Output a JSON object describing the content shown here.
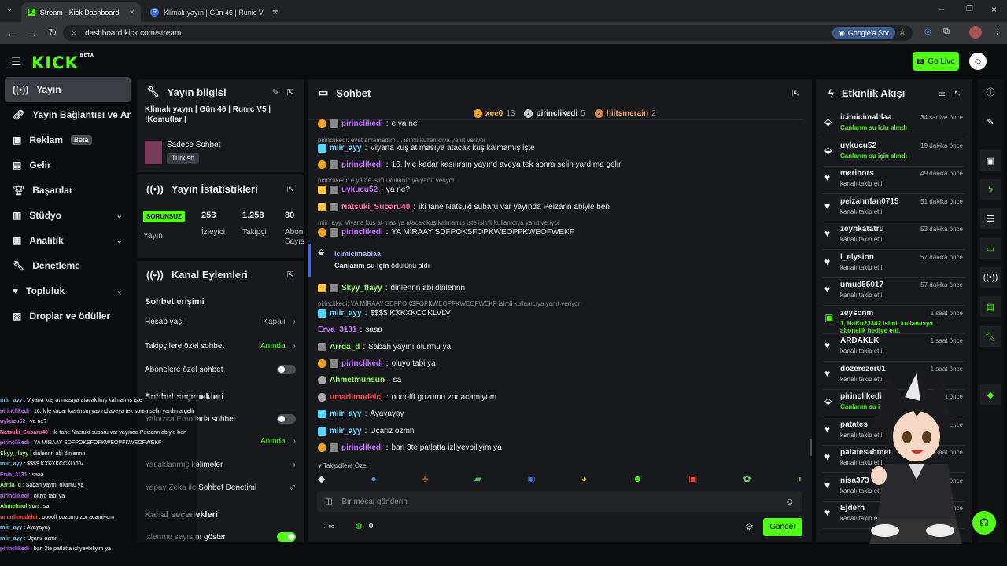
{
  "browser": {
    "tabs": [
      {
        "title": "Stream - Kick Dashboard"
      },
      {
        "title": "Klimalı yayın | Gün 46 | Runic V"
      }
    ],
    "url": "dashboard.kick.com/stream",
    "google_sor": "Google'a Sor"
  },
  "header": {
    "logo": "KICK",
    "logo_tag": "BETA",
    "go_live": "Go Live"
  },
  "sidebar": {
    "items": [
      {
        "label": "Yayın",
        "icon": "broadcast-icon"
      },
      {
        "label": "Yayın Bağlantısı ve Anahtar",
        "icon": "link-icon"
      },
      {
        "label": "Reklam",
        "icon": "ad-icon",
        "badge": "Beta"
      },
      {
        "label": "Gelir",
        "icon": "chart-icon"
      },
      {
        "label": "Başarılar",
        "icon": "trophy-icon"
      },
      {
        "label": "Stüdyo",
        "icon": "studio-icon"
      },
      {
        "label": "Analitik",
        "icon": "analytics-icon"
      },
      {
        "label": "Denetleme",
        "icon": "wrench-icon"
      },
      {
        "label": "Topluluk",
        "icon": "community-icon"
      },
      {
        "label": "Droplar ve ödüller",
        "icon": "gift-icon"
      }
    ]
  },
  "stream_info": {
    "title": "Yayın bilgisi",
    "stream_title": "Klimalı yayın | Gün 46 | Runic V5 | !Komutlar |",
    "category": "Sadece Sohbet",
    "language": "Turkish"
  },
  "stats": {
    "title": "Yayın İstatistikleri",
    "status": "SORUNSUZ",
    "status_label": "Yayın",
    "viewers": "253",
    "viewers_label": "İzleyici",
    "followers": "1.258",
    "followers_label": "Takipçi",
    "subs": "80",
    "subs_label": "Abon Sayısı"
  },
  "channel_actions": {
    "title": "Kanal Eylemleri",
    "chat_access": "Sohbet erişimi",
    "account_age": "Hesap yaşı",
    "account_age_value": "Kapalı",
    "followers_only": "Takipçilere özel sohbet",
    "followers_only_value": "Anında",
    "subs_only": "Abonelere özel sohbet",
    "chat_options": "Sohbet seçenekleri",
    "emotes_only": "Yalnızca Emotlarla sohbet",
    "slow_value": "Anında",
    "banned_words": "Yasaklanmış kelimeler",
    "ai_moderation": "Yapay Zeka ile Sohbet Denetimi",
    "channel_options": "Kanal seçenekleri",
    "show_viewers": "İzlenme sayısını göster"
  },
  "chat": {
    "title": "Sohbet",
    "top": [
      {
        "rank": "1",
        "name": "xee0",
        "count": "13"
      },
      {
        "rank": "2",
        "name": "pirinclikedi",
        "count": "5"
      },
      {
        "rank": "3",
        "name": "hiitsmerain",
        "count": "2"
      }
    ],
    "messages": [
      {
        "user": "pirinclikedi",
        "text": "e ya ne",
        "color": "#c36cff"
      },
      {
        "reply": "pirinclikedi: evet anlamadım ... isimli kullanıcıya yanıt veriyor"
      },
      {
        "user": "miir_ayy",
        "text": "Viyana kuş at masıya atacak kuş kalmamış işte",
        "color": "#6bd3ff"
      },
      {
        "user": "pirinclikedi",
        "text": "16. lvle kadar kasılırsın yayınd aveya tek sonra selin yardıma gelir",
        "color": "#c36cff"
      },
      {
        "reply": "pirinclikedi: e ya ne isimli kullanıcıya yanıt veriyor"
      },
      {
        "user": "uykucu52",
        "text": "ya ne?",
        "color": "#c36cff"
      },
      {
        "user": "Natsuki_Subaru40",
        "text": "iki tane Natsuki subaru var yayında Peizann abiyle ben",
        "color": "#ff6fa8"
      },
      {
        "reply": "miir_ayy: Viyana kuş at masıya atacak kuş kalmamış işte isimli kullanıcıya yanıt veriyor"
      },
      {
        "user": "pirinclikedi",
        "text": "YA MİRAAY SDFPOKSFOPKWEOPFKWEOFWEKF",
        "color": "#c36cff"
      },
      {
        "user": "Skyy_flayy",
        "text": "dinlennn abi dinlennn",
        "color": "#8cff5a"
      },
      {
        "reply": "pirinclikedi: YA MİRAAY SDFPOKSFOPKWEOPFKWEOFWEKF isimli kullanıcıya yanıt veriyor"
      },
      {
        "user": "miir_ayy",
        "text": "$$$$ KXKXKCCKLVLV",
        "color": "#6bd3ff"
      },
      {
        "user": "Erva_3131",
        "text": "saaa",
        "color": "#c36cff"
      },
      {
        "user": "Arrda_d",
        "text": "Sabah yayını olurmu ya",
        "color": "#8cff5a"
      },
      {
        "user": "pirinclikedi",
        "text": "oluyo tabi ya",
        "color": "#c36cff"
      },
      {
        "user": "Ahmetmuhsun",
        "text": "sa",
        "color": "#8cff5a"
      },
      {
        "user": "umarlimodelci",
        "text": "oooofff gozumu zor acamiyom",
        "color": "#ff4d4d"
      },
      {
        "user": "miir_ayy",
        "text": "Ayayayay",
        "color": "#6bd3ff"
      },
      {
        "user": "miir_ayy",
        "text": "Uçarız ozmn",
        "color": "#6bd3ff"
      },
      {
        "user": "pirinclikedi",
        "text": "bari 3te patlatta izliyevbiliyim ya",
        "color": "#c36cff"
      }
    ],
    "event_user": "icimicimablaa",
    "event_text": "Canlarım su için",
    "event_suffix": "ödülünü aldı",
    "emote_label": "Takipçilere Özel",
    "placeholder": "Bir mesaj gönderin",
    "points": "0",
    "send": "Gönder"
  },
  "activity": {
    "title": "Etkinlik Akışı",
    "items": [
      {
        "name": "icimicimablaa",
        "time": "34 saniye önce",
        "sub": "Canlarım su için alındı",
        "kind": "reward"
      },
      {
        "name": "uykucu52",
        "time": "19 dakika önce",
        "sub": "Canlarım su için alındı",
        "kind": "reward"
      },
      {
        "name": "merinors",
        "time": "49 dakika önce",
        "sub": "kanalı takip etti",
        "kind": "follow"
      },
      {
        "name": "peizannfan0715",
        "time": "51 dakika önce",
        "sub": "kanalı takip etti",
        "kind": "follow"
      },
      {
        "name": "zeynkatatru",
        "time": "53 dakika önce",
        "sub": "kanalı takip etti",
        "kind": "follow"
      },
      {
        "name": "l_elysion",
        "time": "57 dakika önce",
        "sub": "kanalı takip etti",
        "kind": "follow"
      },
      {
        "name": "umud55017",
        "time": "57 dakika önce",
        "sub": "kanalı takip etti",
        "kind": "follow"
      },
      {
        "name": "zeyscnm",
        "time": "1 saat önce",
        "sub": "1, HaKu23342 isimli kullanıcıya abonelik hediye etti.",
        "kind": "gift"
      },
      {
        "name": "ARDAKLK",
        "time": "1 saat önce",
        "sub": "kanalı takip etti",
        "kind": "follow"
      },
      {
        "name": "dozerezer01",
        "time": "1 saat önce",
        "sub": "kanalı takip etti",
        "kind": "follow"
      },
      {
        "name": "pirinclikedi",
        "time": "1 saat önce",
        "sub": "Canlarım su için alındı",
        "kind": "reward"
      },
      {
        "name": "patates",
        "time": "1 saat önce",
        "sub": "kanalı takip etti",
        "kind": "follow"
      },
      {
        "name": "patatesahmet",
        "time": "1 saat önce",
        "sub": "kanalı takip etti",
        "kind": "follow"
      },
      {
        "name": "nisa373",
        "time": "1 saat önce",
        "sub": "kanalı takip etti",
        "kind": "follow"
      },
      {
        "name": "Ejderh",
        "time": "1 saat önce",
        "sub": "kanalı takip etti",
        "kind": "follow"
      }
    ]
  },
  "overlay_chat": [
    {
      "u": "miir_ayy",
      "t": "Viyana kuş at masıya atacak kuş kalmamış işte",
      "c": "#6bd3ff"
    },
    {
      "u": "pirinclikedi",
      "t": "16. lvle kadar kasılırsın yayınd aveya tek sonra selin yardıma gelir",
      "c": "#c36cff"
    },
    {
      "u": "uykucu52",
      "t": "ya ne?",
      "c": "#c36cff"
    },
    {
      "u": "Natsuki_Subaru40",
      "t": "iki tane Natsuki subaru var yayında Peizann abiyle ben",
      "c": "#ff6fa8"
    },
    {
      "u": "pirinclikedi",
      "t": "YA MİRAAY SDFPOKSFOPKWEOPFKWEOFWEKF",
      "c": "#c36cff"
    },
    {
      "u": "Skyy_flayy",
      "t": "dinlennn abi dinlennn",
      "c": "#8cff5a"
    },
    {
      "u": "miir_ayy",
      "t": "$$$$ KXKXKCCKLVLV",
      "c": "#6bd3ff"
    },
    {
      "u": "Erva_3131",
      "t": "saaa",
      "c": "#c36cff"
    },
    {
      "u": "Arrda_d",
      "t": "Sabah yayını olurmu ya",
      "c": "#8cff5a"
    },
    {
      "u": "pirinclikedi",
      "t": "oluyo tabi ya",
      "c": "#c36cff"
    },
    {
      "u": "Ahmetmuhsun",
      "t": "sa",
      "c": "#8cff5a"
    },
    {
      "u": "umarlimodelci",
      "t": "ooooff gozumu zor acamiyom",
      "c": "#ff4d4d"
    },
    {
      "u": "miir_ayy",
      "t": "Ayayayay",
      "c": "#6bd3ff"
    },
    {
      "u": "miir_ayy",
      "t": "Uçarız ozmn",
      "c": "#6bd3ff"
    },
    {
      "u": "pirinclikedi",
      "t": "bari 3te patlatta izliyevbiliyim ya",
      "c": "#c36cff"
    }
  ]
}
